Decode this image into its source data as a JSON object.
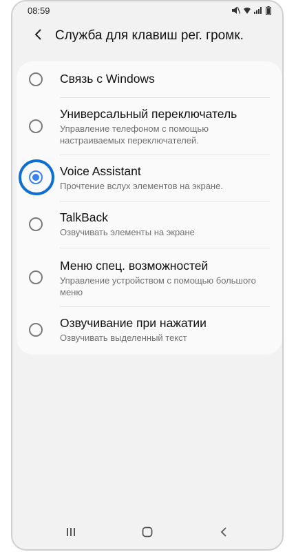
{
  "status_bar": {
    "time": "08:59"
  },
  "header": {
    "title": "Служба для клавиш рег. громк."
  },
  "options": [
    {
      "label": "Связь с Windows",
      "description": "",
      "selected": false
    },
    {
      "label": "Универсальный переключатель",
      "description": "Управление телефоном с помощью настраиваемых переключателей.",
      "selected": false
    },
    {
      "label": "Voice Assistant",
      "description": "Прочтение вслух элементов на экране.",
      "selected": true
    },
    {
      "label": "TalkBack",
      "description": "Озвучивать элементы на экране",
      "selected": false
    },
    {
      "label": "Меню спец. возможностей",
      "description": "Управление устройством с помощью большого меню",
      "selected": false
    },
    {
      "label": "Озвучивание при нажатии",
      "description": "Озвучивать выделенный текст",
      "selected": false
    }
  ],
  "colors": {
    "accent": "#3b82f0",
    "highlight": "#0c6fd1",
    "background": "#f2f2f2"
  },
  "icons": [
    "mute-icon",
    "wifi-icon",
    "signal-icon",
    "battery-icon",
    "back-arrow-icon",
    "recents-icon",
    "home-icon",
    "back-nav-icon"
  ]
}
